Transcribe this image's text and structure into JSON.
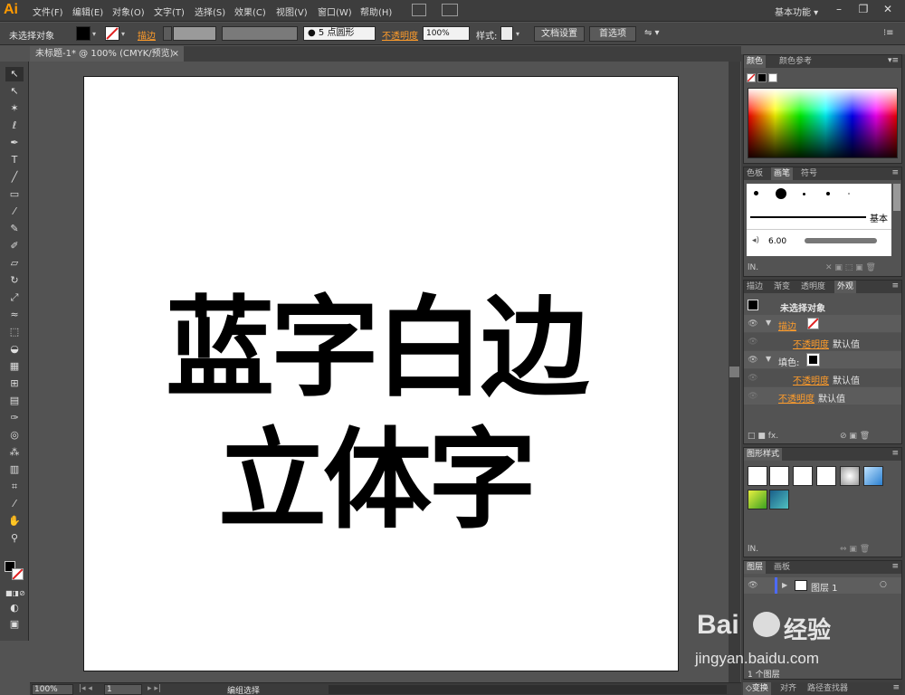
{
  "app": {
    "logo": "Ai"
  },
  "menu": {
    "items": [
      "文件(F)",
      "编辑(E)",
      "对象(O)",
      "文字(T)",
      "选择(S)",
      "效果(C)",
      "视图(V)",
      "窗口(W)",
      "帮助(H)"
    ],
    "workspace": "基本功能"
  },
  "control": {
    "selection": "未选择对象",
    "stroke": "描边",
    "brush": "5 点圆形",
    "opacity": "不透明度",
    "opacity_value": "100%",
    "style": "样式:",
    "doc_setup": "文档设置",
    "preferences": "首选项"
  },
  "document": {
    "tab": "未标题-1* @ 100% (CMYK/预览)",
    "line1": "蓝字白边",
    "line2": "立体字"
  },
  "status": {
    "zoom": "100%",
    "page": "1",
    "tool": "编组选择"
  },
  "panels": {
    "color": {
      "tabs": [
        "颜色",
        "颜色参考"
      ]
    },
    "brushes": {
      "tabs": [
        "色板",
        "画笔",
        "符号"
      ],
      "basic": "基本",
      "size": "6.00"
    },
    "appearance": {
      "tabs": [
        "描边",
        "渐变",
        "透明度",
        "外观"
      ],
      "title": "未选择对象",
      "stroke": "描边",
      "opacity": "不透明度",
      "default": "默认值",
      "fill": "填色:"
    },
    "graphic_styles": {
      "tabs": [
        "图形样式"
      ]
    },
    "layers": {
      "tabs": [
        "图层",
        "画板"
      ],
      "layer_name": "图层 1",
      "count": "1 个图层"
    },
    "bottom": {
      "tabs": [
        "变换",
        "对齐",
        "路径查找器"
      ]
    }
  },
  "watermark": {
    "brand": "Bai",
    "brand2": "经验",
    "url": "jingyan.baidu.com"
  }
}
